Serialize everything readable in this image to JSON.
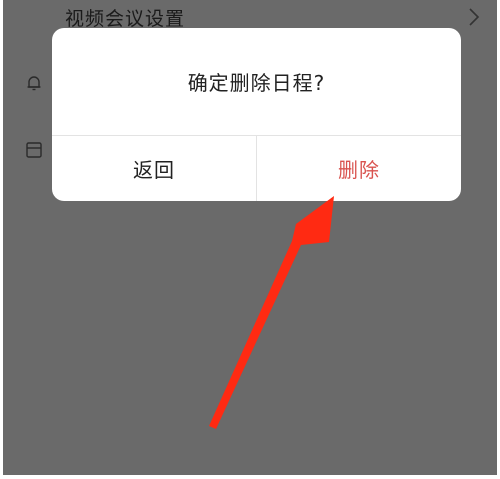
{
  "background": {
    "row_title": "视频会议设置",
    "icons": [
      "chevron-right-icon",
      "bell-icon",
      "calendar-icon"
    ]
  },
  "dialog": {
    "title": "确定删除日程?",
    "back_label": "返回",
    "delete_label": "删除"
  },
  "colors": {
    "overlay": "#6a6a6a",
    "dialog_bg": "#ffffff",
    "delete_text": "#d9534f",
    "annotation_arrow": "#ff2a12"
  }
}
